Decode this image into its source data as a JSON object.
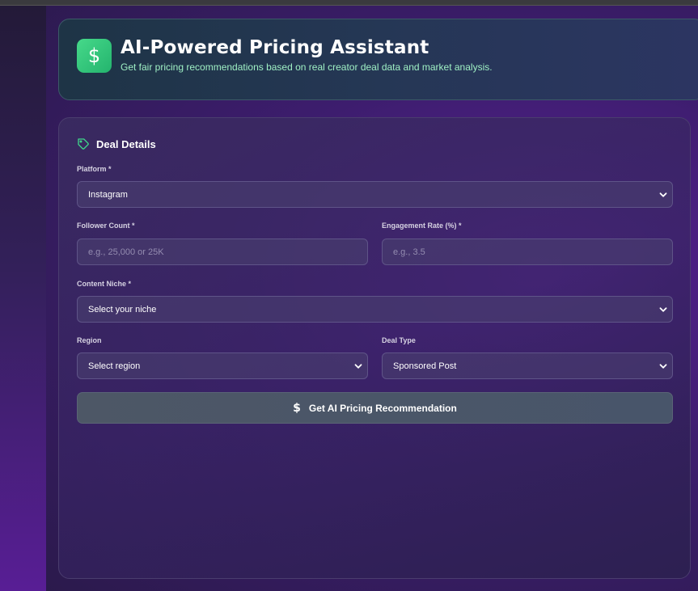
{
  "header": {
    "icon": "dollar-icon",
    "icon_glyph": "$",
    "title": "AI-Powered Pricing Assistant",
    "subtitle": "Get fair pricing recommendations based on real creator deal data and market analysis."
  },
  "form": {
    "title": "Deal Details",
    "title_icon": "tag-icon",
    "platform": {
      "label": "Platform *",
      "value": "Instagram"
    },
    "followers": {
      "label": "Follower Count *",
      "value": "",
      "placeholder": "e.g., 25,000 or 25K"
    },
    "engagement": {
      "label": "Engagement Rate (%) *",
      "value": "",
      "placeholder": "e.g., 3.5"
    },
    "niche": {
      "label": "Content Niche *",
      "value": "Select your niche"
    },
    "region": {
      "label": "Region",
      "value": "Select region"
    },
    "deal_type": {
      "label": "Deal Type",
      "value": "Sponsored Post"
    },
    "submit": {
      "icon_glyph": "$",
      "label": "Get AI Pricing Recommendation"
    }
  },
  "colors": {
    "accent_green": "#2ec77a",
    "subtitle_green": "#9ff0c4",
    "background_purple": "#4c1d84"
  }
}
